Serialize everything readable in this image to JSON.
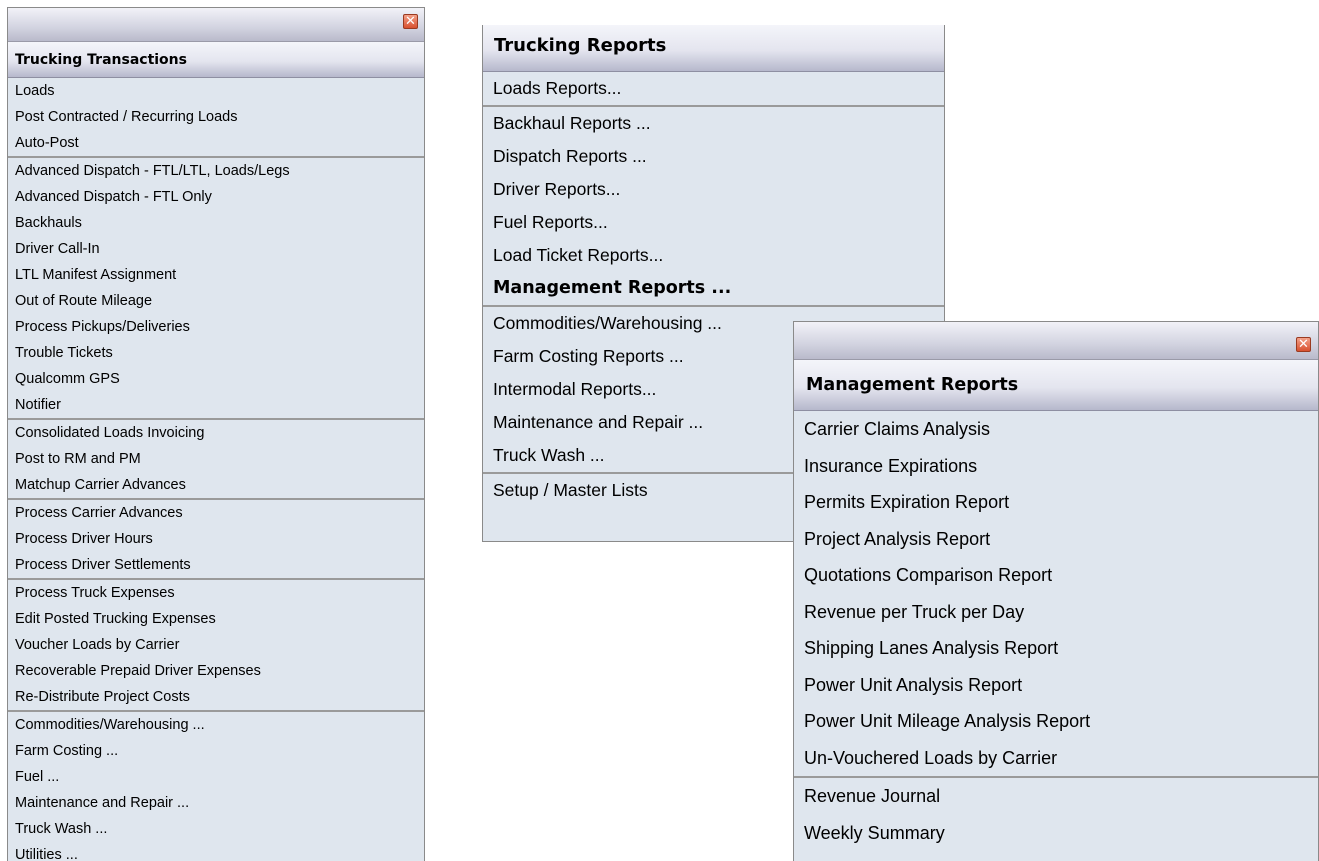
{
  "transactions_panel": {
    "close_glyph": "✕",
    "header": "Trucking Transactions",
    "groups": [
      [
        "Loads",
        "Post Contracted / Recurring Loads",
        "Auto-Post"
      ],
      [
        "Advanced Dispatch - FTL/LTL, Loads/Legs",
        "Advanced Dispatch - FTL Only",
        "Backhauls",
        "Driver Call-In",
        "LTL Manifest Assignment",
        "Out of Route Mileage",
        "Process Pickups/Deliveries",
        "Trouble Tickets",
        "Qualcomm GPS",
        "Notifier"
      ],
      [
        "Consolidated Loads Invoicing",
        "Post to RM and PM",
        "Matchup Carrier Advances"
      ],
      [
        "Process Carrier Advances",
        "Process Driver Hours",
        "Process Driver Settlements"
      ],
      [
        "Process Truck Expenses",
        "Edit Posted Trucking Expenses",
        "Voucher Loads by Carrier",
        "Recoverable Prepaid Driver Expenses",
        "Re-Distribute Project Costs"
      ],
      [
        "Commodities/Warehousing ...",
        "Farm Costing ...",
        "Fuel ...",
        "Maintenance and Repair ...",
        "Truck Wash ...",
        "Utilities ..."
      ]
    ]
  },
  "reports_panel": {
    "header": "Trucking Reports",
    "groups": [
      [
        "Loads Reports..."
      ],
      [
        "Backhaul Reports ...",
        "Dispatch Reports ...",
        "Driver Reports...",
        "Fuel Reports...",
        "Load Ticket Reports...",
        "Management Reports ..."
      ],
      [
        "Commodities/Warehousing ...",
        "Farm Costing Reports ...",
        "Intermodal Reports...",
        "Maintenance and Repair ...",
        "Truck Wash ..."
      ],
      [
        "Setup / Master Lists"
      ]
    ],
    "bold_item": "Management Reports ..."
  },
  "management_panel": {
    "close_glyph": "✕",
    "header": "Management Reports",
    "groups": [
      [
        "Carrier Claims Analysis",
        "Insurance Expirations",
        "Permits Expiration Report",
        "Project Analysis Report",
        "Quotations Comparison Report",
        "Revenue per Truck per Day",
        "Shipping Lanes Analysis Report",
        "Power Unit Analysis Report",
        "Power Unit Mileage Analysis Report",
        "Un-Vouchered Loads by Carrier"
      ],
      [
        "Revenue Journal",
        "Weekly Summary"
      ]
    ]
  }
}
